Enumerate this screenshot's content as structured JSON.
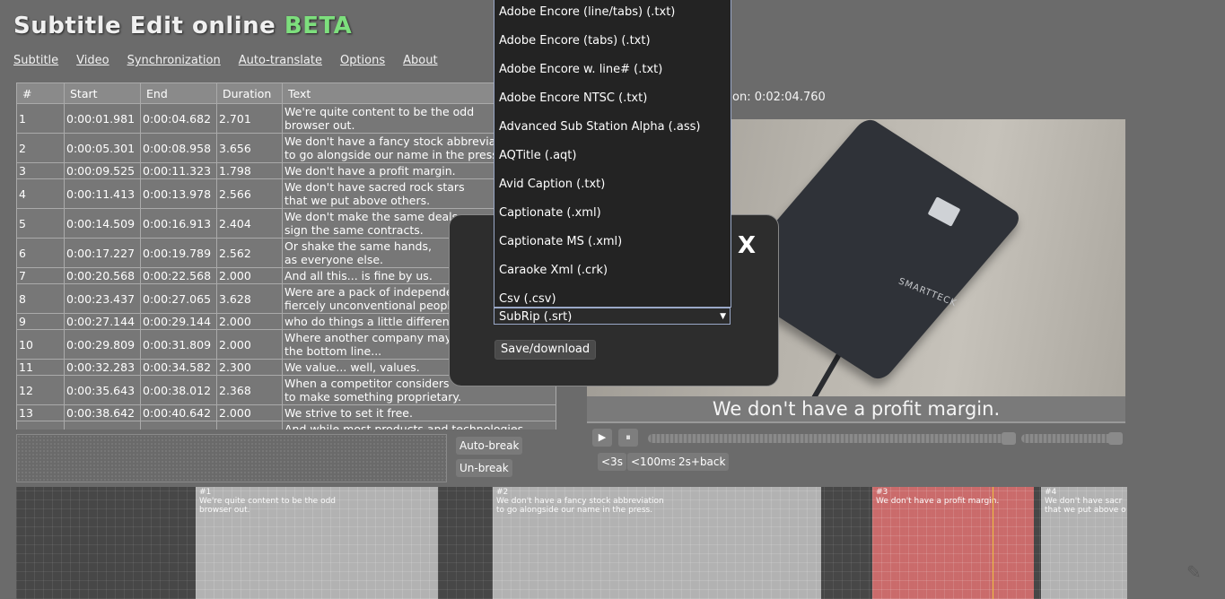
{
  "app": {
    "title": "Subtitle Edit online",
    "beta": "BETA"
  },
  "menu": [
    "Subtitle",
    "Video",
    "Synchronization",
    "Auto-translate",
    "Options",
    "About"
  ],
  "table": {
    "headers": [
      "#",
      "Start",
      "End",
      "Duration",
      "Text"
    ],
    "rows": [
      [
        "1",
        "0:00:01.981",
        "0:00:04.682",
        "2.701",
        "We're quite content to be the odd\nbrowser out."
      ],
      [
        "2",
        "0:00:05.301",
        "0:00:08.958",
        "3.656",
        "We don't have a fancy stock abbreviation\nto go alongside our name in the press."
      ],
      [
        "3",
        "0:00:09.525",
        "0:00:11.323",
        "1.798",
        "We don't have a profit margin."
      ],
      [
        "4",
        "0:00:11.413",
        "0:00:13.978",
        "2.566",
        "We don't have sacred rock stars\nthat we put above others."
      ],
      [
        "5",
        "0:00:14.509",
        "0:00:16.913",
        "2.404",
        "We don't make the same deals,\nsign the same contracts."
      ],
      [
        "6",
        "0:00:17.227",
        "0:00:19.789",
        "2.562",
        "Or shake the same hands,\nas everyone else."
      ],
      [
        "7",
        "0:00:20.568",
        "0:00:22.568",
        "2.000",
        "And all this... is fine by us."
      ],
      [
        "8",
        "0:00:23.437",
        "0:00:27.065",
        "3.628",
        "Were are a pack of independently\nfiercely unconventional people,"
      ],
      [
        "9",
        "0:00:27.144",
        "0:00:29.144",
        "2.000",
        "who do things a little differently"
      ],
      [
        "10",
        "0:00:29.809",
        "0:00:31.809",
        "2.000",
        "Where another company may val\nthe bottom line..."
      ],
      [
        "11",
        "0:00:32.283",
        "0:00:34.582",
        "2.300",
        "We value... well, values."
      ],
      [
        "12",
        "0:00:35.643",
        "0:00:38.012",
        "2.368",
        "When a competitor considers\nto make something proprietary."
      ],
      [
        "13",
        "0:00:38.642",
        "0:00:40.642",
        "2.000",
        "We strive to set it free."
      ],
      [
        "",
        "",
        "",
        "",
        "And while most products and technologies"
      ]
    ]
  },
  "editor": {
    "auto_break": "Auto-break",
    "un_break": "Un-break"
  },
  "video": {
    "duration_text": "on: 0:02:04.760",
    "caption": "We don't have a profit margin.",
    "brand": "SMARTTECK",
    "play_icon": "▶",
    "pause_icon": "⏸",
    "seek_progress": 0.99,
    "volume_level": 0.99,
    "buttons": [
      "<3s",
      "<100ms",
      "2s+back"
    ]
  },
  "waveform": {
    "segments": [
      {
        "label": "#1",
        "text": "We're quite content to be the odd\nbrowser out.",
        "selected": false
      },
      {
        "label": "#2",
        "text": "We don't have a fancy stock abbreviation\nto go alongside our name in the press.",
        "selected": false
      },
      {
        "label": "#3",
        "text": "We don't have a profit margin.",
        "selected": true
      },
      {
        "label": "#4",
        "text": "We don't have sacr\nthat we put above o",
        "selected": false
      }
    ]
  },
  "modal": {
    "close": "X",
    "format_selected": "SubRip (.srt)",
    "save_label": "Save/download",
    "formats": [
      "Adobe Encore (line/tabs) (.txt)",
      "Adobe Encore (tabs) (.txt)",
      "Adobe Encore w. line# (.txt)",
      "Adobe Encore NTSC (.txt)",
      "Advanced Sub Station Alpha (.ass)",
      "AQTitle (.aqt)",
      "Avid Caption (.txt)",
      "Captionate (.xml)",
      "Captionate MS (.xml)",
      "Caraoke Xml (.crk)",
      "Csv (.csv)"
    ]
  }
}
